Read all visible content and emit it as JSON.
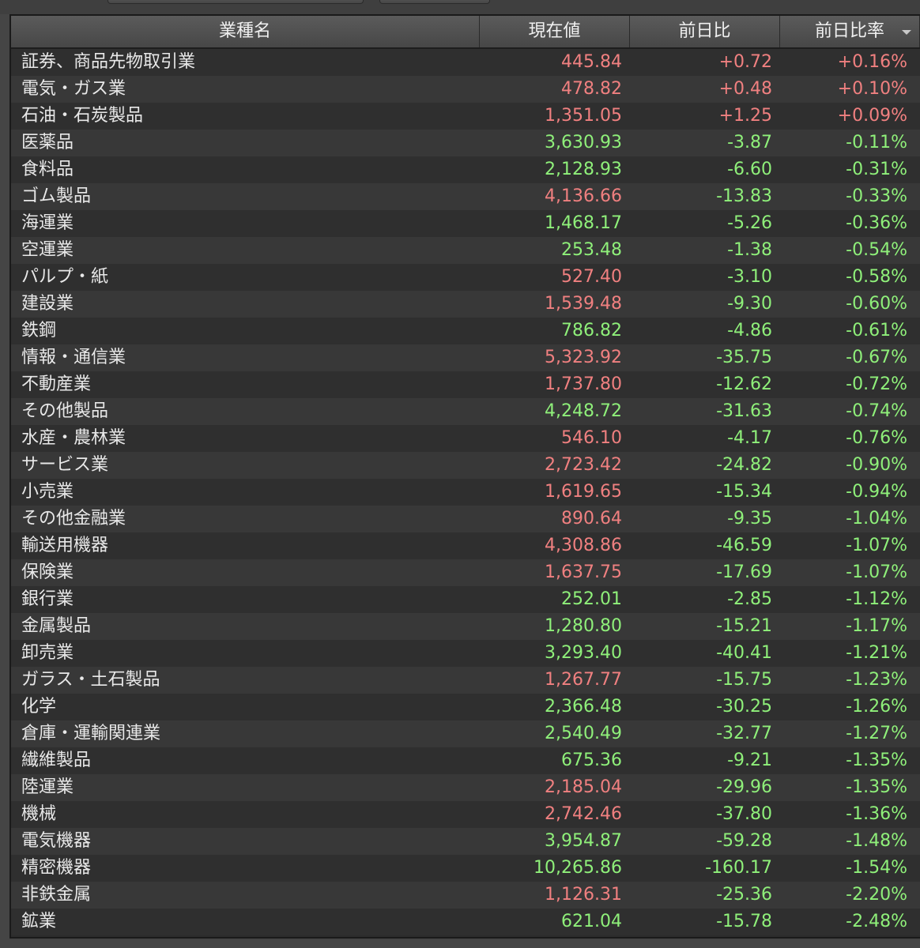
{
  "colors": {
    "up": "#f08080",
    "down": "#8ff07a",
    "header_bg": "#505050",
    "row_bg": "#2f2f2f"
  },
  "header": {
    "name": "業種名",
    "price": "現在値",
    "change": "前日比",
    "change_pct": "前日比率"
  },
  "rows": [
    {
      "name": "証券、商品先物取引業",
      "price": "445.84",
      "price_dir": "up",
      "change": "+0.72",
      "change_dir": "up",
      "pct": "+0.16%",
      "pct_dir": "up"
    },
    {
      "name": "電気・ガス業",
      "price": "478.82",
      "price_dir": "up",
      "change": "+0.48",
      "change_dir": "up",
      "pct": "+0.10%",
      "pct_dir": "up"
    },
    {
      "name": "石油・石炭製品",
      "price": "1,351.05",
      "price_dir": "up",
      "change": "+1.25",
      "change_dir": "up",
      "pct": "+0.09%",
      "pct_dir": "up"
    },
    {
      "name": "医薬品",
      "price": "3,630.93",
      "price_dir": "down",
      "change": "-3.87",
      "change_dir": "down",
      "pct": "-0.11%",
      "pct_dir": "down"
    },
    {
      "name": "食料品",
      "price": "2,128.93",
      "price_dir": "down",
      "change": "-6.60",
      "change_dir": "down",
      "pct": "-0.31%",
      "pct_dir": "down"
    },
    {
      "name": "ゴム製品",
      "price": "4,136.66",
      "price_dir": "up",
      "change": "-13.83",
      "change_dir": "down",
      "pct": "-0.33%",
      "pct_dir": "down"
    },
    {
      "name": "海運業",
      "price": "1,468.17",
      "price_dir": "down",
      "change": "-5.26",
      "change_dir": "down",
      "pct": "-0.36%",
      "pct_dir": "down"
    },
    {
      "name": "空運業",
      "price": "253.48",
      "price_dir": "down",
      "change": "-1.38",
      "change_dir": "down",
      "pct": "-0.54%",
      "pct_dir": "down"
    },
    {
      "name": "パルプ・紙",
      "price": "527.40",
      "price_dir": "up",
      "change": "-3.10",
      "change_dir": "down",
      "pct": "-0.58%",
      "pct_dir": "down"
    },
    {
      "name": "建設業",
      "price": "1,539.48",
      "price_dir": "up",
      "change": "-9.30",
      "change_dir": "down",
      "pct": "-0.60%",
      "pct_dir": "down"
    },
    {
      "name": "鉄鋼",
      "price": "786.82",
      "price_dir": "down",
      "change": "-4.86",
      "change_dir": "down",
      "pct": "-0.61%",
      "pct_dir": "down"
    },
    {
      "name": "情報・通信業",
      "price": "5,323.92",
      "price_dir": "up",
      "change": "-35.75",
      "change_dir": "down",
      "pct": "-0.67%",
      "pct_dir": "down"
    },
    {
      "name": "不動産業",
      "price": "1,737.80",
      "price_dir": "up",
      "change": "-12.62",
      "change_dir": "down",
      "pct": "-0.72%",
      "pct_dir": "down"
    },
    {
      "name": "その他製品",
      "price": "4,248.72",
      "price_dir": "down",
      "change": "-31.63",
      "change_dir": "down",
      "pct": "-0.74%",
      "pct_dir": "down"
    },
    {
      "name": "水産・農林業",
      "price": "546.10",
      "price_dir": "up",
      "change": "-4.17",
      "change_dir": "down",
      "pct": "-0.76%",
      "pct_dir": "down"
    },
    {
      "name": "サービス業",
      "price": "2,723.42",
      "price_dir": "up",
      "change": "-24.82",
      "change_dir": "down",
      "pct": "-0.90%",
      "pct_dir": "down"
    },
    {
      "name": "小売業",
      "price": "1,619.65",
      "price_dir": "up",
      "change": "-15.34",
      "change_dir": "down",
      "pct": "-0.94%",
      "pct_dir": "down"
    },
    {
      "name": "その他金融業",
      "price": "890.64",
      "price_dir": "up",
      "change": "-9.35",
      "change_dir": "down",
      "pct": "-1.04%",
      "pct_dir": "down"
    },
    {
      "name": "輸送用機器",
      "price": "4,308.86",
      "price_dir": "up",
      "change": "-46.59",
      "change_dir": "down",
      "pct": "-1.07%",
      "pct_dir": "down"
    },
    {
      "name": "保険業",
      "price": "1,637.75",
      "price_dir": "up",
      "change": "-17.69",
      "change_dir": "down",
      "pct": "-1.07%",
      "pct_dir": "down"
    },
    {
      "name": "銀行業",
      "price": "252.01",
      "price_dir": "down",
      "change": "-2.85",
      "change_dir": "down",
      "pct": "-1.12%",
      "pct_dir": "down"
    },
    {
      "name": "金属製品",
      "price": "1,280.80",
      "price_dir": "down",
      "change": "-15.21",
      "change_dir": "down",
      "pct": "-1.17%",
      "pct_dir": "down"
    },
    {
      "name": "卸売業",
      "price": "3,293.40",
      "price_dir": "down",
      "change": "-40.41",
      "change_dir": "down",
      "pct": "-1.21%",
      "pct_dir": "down"
    },
    {
      "name": "ガラス・土石製品",
      "price": "1,267.77",
      "price_dir": "up",
      "change": "-15.75",
      "change_dir": "down",
      "pct": "-1.23%",
      "pct_dir": "down"
    },
    {
      "name": "化学",
      "price": "2,366.48",
      "price_dir": "down",
      "change": "-30.25",
      "change_dir": "down",
      "pct": "-1.26%",
      "pct_dir": "down"
    },
    {
      "name": "倉庫・運輸関連業",
      "price": "2,540.49",
      "price_dir": "down",
      "change": "-32.77",
      "change_dir": "down",
      "pct": "-1.27%",
      "pct_dir": "down"
    },
    {
      "name": "繊維製品",
      "price": "675.36",
      "price_dir": "down",
      "change": "-9.21",
      "change_dir": "down",
      "pct": "-1.35%",
      "pct_dir": "down"
    },
    {
      "name": "陸運業",
      "price": "2,185.04",
      "price_dir": "up",
      "change": "-29.96",
      "change_dir": "down",
      "pct": "-1.35%",
      "pct_dir": "down"
    },
    {
      "name": "機械",
      "price": "2,742.46",
      "price_dir": "up",
      "change": "-37.80",
      "change_dir": "down",
      "pct": "-1.36%",
      "pct_dir": "down"
    },
    {
      "name": "電気機器",
      "price": "3,954.87",
      "price_dir": "down",
      "change": "-59.28",
      "change_dir": "down",
      "pct": "-1.48%",
      "pct_dir": "down"
    },
    {
      "name": "精密機器",
      "price": "10,265.86",
      "price_dir": "down",
      "change": "-160.17",
      "change_dir": "down",
      "pct": "-1.54%",
      "pct_dir": "down"
    },
    {
      "name": "非鉄金属",
      "price": "1,126.31",
      "price_dir": "up",
      "change": "-25.36",
      "change_dir": "down",
      "pct": "-2.20%",
      "pct_dir": "down"
    },
    {
      "name": "鉱業",
      "price": "621.04",
      "price_dir": "down",
      "change": "-15.78",
      "change_dir": "down",
      "pct": "-2.48%",
      "pct_dir": "down"
    }
  ]
}
